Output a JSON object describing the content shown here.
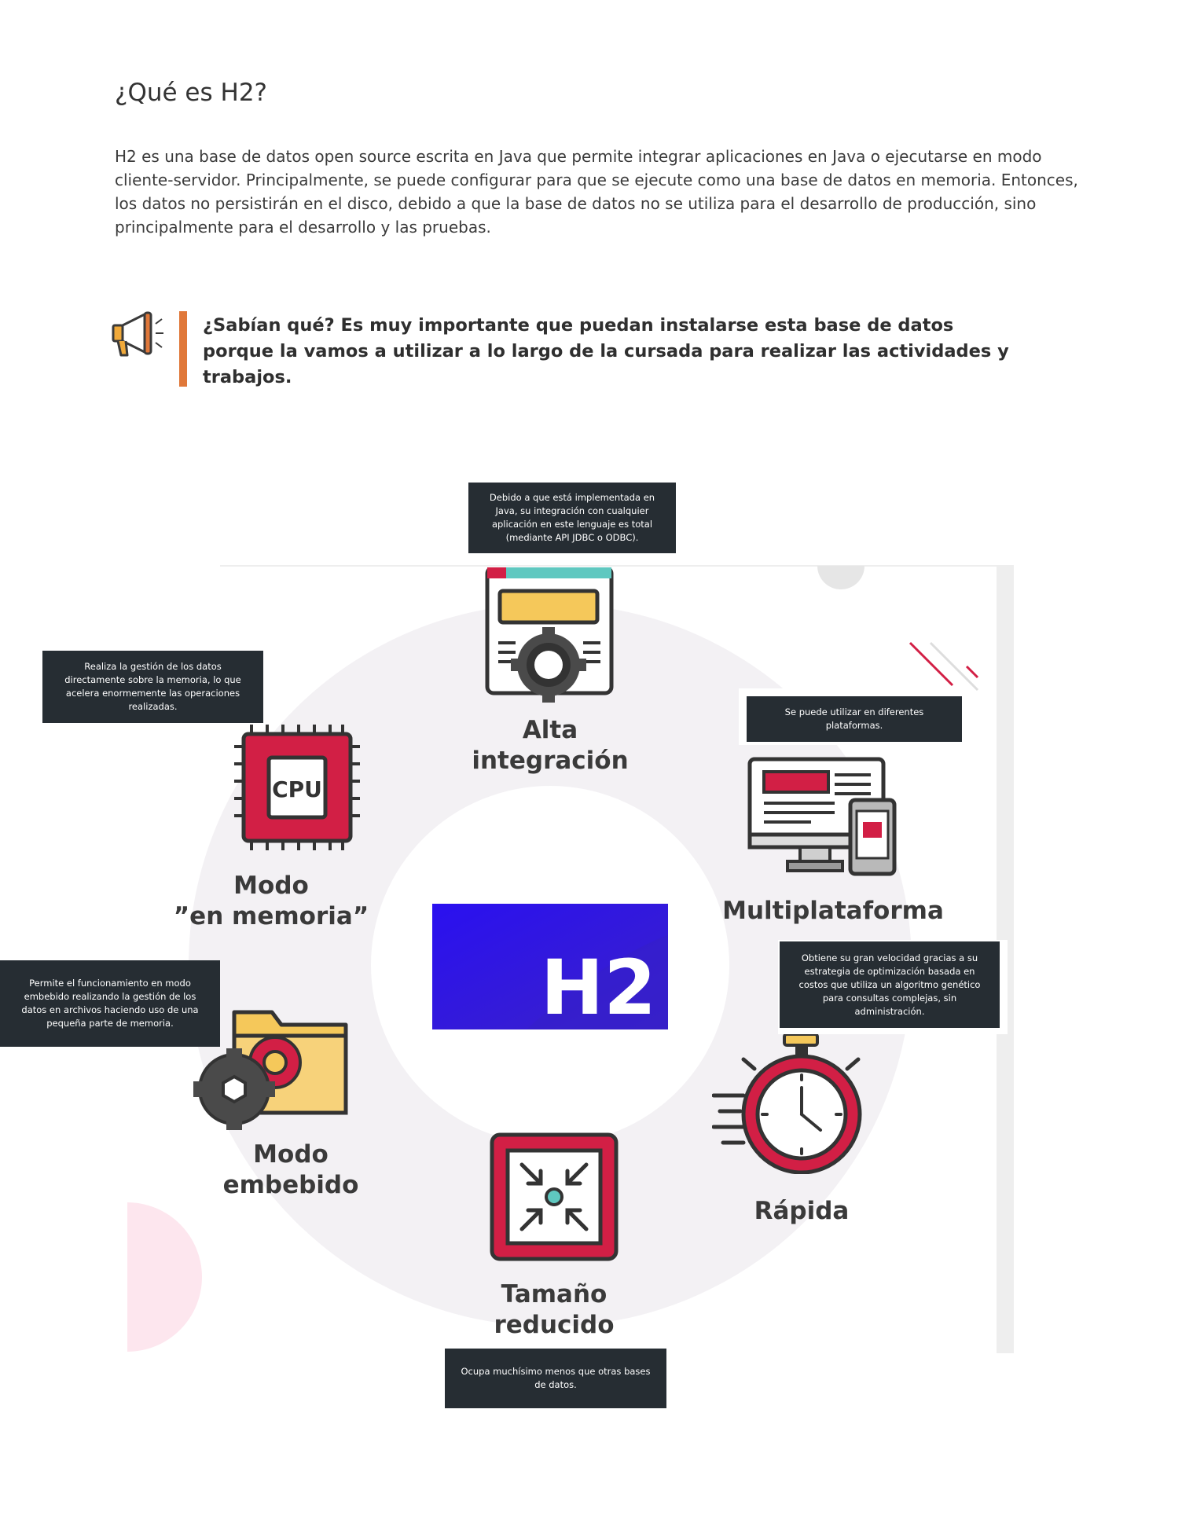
{
  "section": {
    "title": "¿Qué es H2?",
    "intro": "H2 es una base de datos open source escrita en Java que permite integrar aplicaciones en Java o ejecutarse en modo cliente-servidor. Principalmente, se puede configurar para que se ejecute como una base de datos en memoria. Entonces, los datos no persistirán en el disco, debido a que la base de datos no se utiliza para el desarrollo de producción, sino principalmente para el desarrollo y las pruebas."
  },
  "callout": {
    "icon": "megaphone-icon",
    "text": "¿Sabían qué? Es muy importante que puedan instalarse esta base de datos porque la vamos a utilizar a lo largo de la cursada para realizar las actividades y trabajos."
  },
  "infographic": {
    "logo_text": "H2",
    "colors": {
      "accent_red": "#d21f45",
      "logo_blue": "#2f16e6",
      "tooltip_bg": "#262d33",
      "icon_yellow": "#f5c85a",
      "icon_teal": "#5fc8c0"
    },
    "features": {
      "alta_integracion": {
        "line1": "Alta",
        "line2": "integración",
        "icon": "gear-document-icon",
        "tooltip": "Debido a que está implementada en Java, su integración con cualquier aplicación en este lenguaje es total (mediante API JDBC o ODBC)."
      },
      "en_memoria": {
        "line1": "Modo",
        "line2": "”en memoria”",
        "icon": "cpu-chip-icon",
        "chip_text": "CPU",
        "tooltip": "Realiza la gestión de los datos directamente sobre la memoria, lo que acelera enormemente las operaciones realizadas."
      },
      "multiplataforma": {
        "line1": "Multiplataforma",
        "icon": "devices-icon",
        "tooltip": "Se puede utilizar en diferentes plataformas."
      },
      "embebido": {
        "line1": "Modo",
        "line2": "embebido",
        "icon": "folder-gears-icon",
        "tooltip": "Permite el funcionamiento en modo embebido realizando la gestión de los datos en archivos haciendo uso de una pequeña parte de memoria."
      },
      "rapida": {
        "line1": "Rápida",
        "icon": "stopwatch-icon",
        "tooltip": "Obtiene su gran velocidad gracias a su estrategia de optimización basada en costos que utiliza un algoritmo genético para consultas complejas, sin administración."
      },
      "tamano": {
        "line1": "Tamaño",
        "line2": "reducido",
        "icon": "compress-icon",
        "tooltip": "Ocupa muchísimo menos que otras bases de datos."
      }
    }
  }
}
